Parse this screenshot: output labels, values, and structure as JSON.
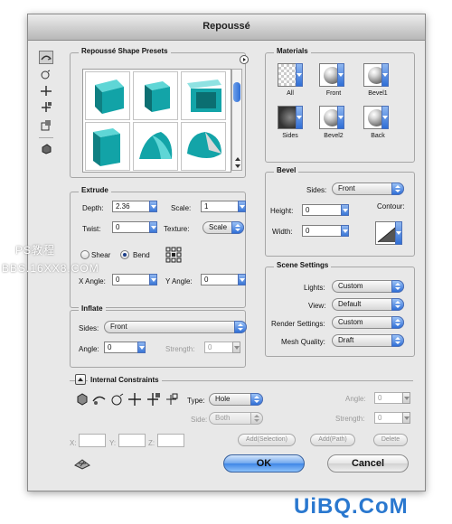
{
  "window": {
    "title": "Repoussé"
  },
  "presets": {
    "title": "Repoussé Shape Presets"
  },
  "extrude": {
    "title": "Extrude",
    "depth_label": "Depth:",
    "depth_value": "2.36",
    "scale_label": "Scale:",
    "scale_value": "1",
    "twist_label": "Twist:",
    "twist_value": "0",
    "texture_label": "Texture:",
    "texture_value": "Scale",
    "shear_label": "Shear",
    "bend_label": "Bend",
    "xangle_label": "X Angle:",
    "xangle_value": "0",
    "yangle_label": "Y Angle:",
    "yangle_value": "0"
  },
  "inflate": {
    "title": "Inflate",
    "sides_label": "Sides:",
    "sides_value": "Front",
    "angle_label": "Angle:",
    "angle_value": "0",
    "strength_label": "Strength:",
    "strength_value": "0"
  },
  "materials": {
    "title": "Materials",
    "items": [
      "All",
      "Front",
      "Bevel1",
      "Sides",
      "Bevel2",
      "Back"
    ]
  },
  "bevel": {
    "title": "Bevel",
    "sides_label": "Sides:",
    "sides_value": "Front",
    "height_label": "Height:",
    "height_value": "0",
    "width_label": "Width:",
    "width_value": "0",
    "contour_label": "Contour:"
  },
  "scene": {
    "title": "Scene Settings",
    "lights_label": "Lights:",
    "lights_value": "Custom",
    "view_label": "View:",
    "view_value": "Default",
    "render_label": "Render Settings:",
    "render_value": "Custom",
    "mesh_label": "Mesh Quality:",
    "mesh_value": "Draft"
  },
  "constraints": {
    "title": "Internal Constraints",
    "type_label": "Type:",
    "type_value": "Hole",
    "side_label": "Side:",
    "side_value": "Both",
    "angle_label": "Angle:",
    "angle_value": "0",
    "strength_label": "Strength:",
    "strength_value": "0",
    "x_label": "X:",
    "y_label": "Y:",
    "z_label": "Z:",
    "add_selection": "Add(Selection)",
    "add_path": "Add(Path)",
    "delete": "Delete"
  },
  "buttons": {
    "ok": "OK",
    "cancel": "Cancel"
  },
  "watermark": {
    "line1": "PS教程",
    "line2": "BBS.16XX8.COM",
    "corner": "UiBQ.CoM"
  },
  "colors": {
    "accent_blue": "#3b77d7",
    "preset_teal": "#13a4a8",
    "watermark_red": "#cc0000"
  }
}
